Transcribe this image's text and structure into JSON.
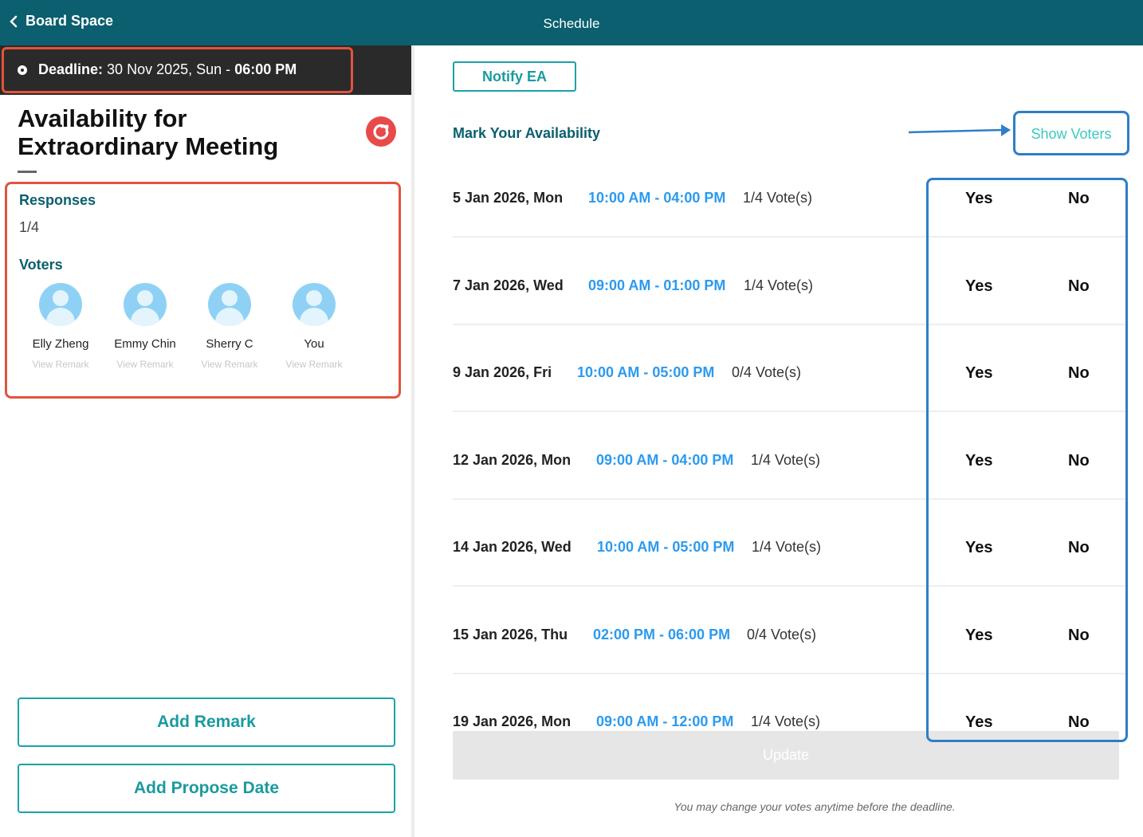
{
  "topbar": {
    "back_label": "Board Space",
    "title": "Schedule"
  },
  "deadline": {
    "label": "Deadline:",
    "date": "30 Nov 2025, Sun",
    "separator": "-",
    "time": "06:00 PM"
  },
  "meeting": {
    "title": "Availability for Extraordinary Meeting"
  },
  "responses": {
    "label": "Responses",
    "value": "1/4",
    "voters_label": "Voters",
    "voters": [
      {
        "name": "Elly Zheng",
        "remark": "View Remark"
      },
      {
        "name": "Emmy Chin",
        "remark": "View Remark"
      },
      {
        "name": "Sherry C",
        "remark": "View Remark"
      },
      {
        "name": "You",
        "remark": "View Remark"
      }
    ]
  },
  "buttons": {
    "add_remark": "Add Remark",
    "add_propose_date": "Add Propose Date",
    "notify_ea": "Notify EA",
    "update": "Update"
  },
  "availability": {
    "heading": "Mark Your Availability",
    "show_voters": "Show Voters",
    "rows": [
      {
        "date": "5 Jan 2026, Mon",
        "time": "10:00 AM - 04:00 PM",
        "votes": "1/4 Vote(s)",
        "yes": "Yes",
        "no": "No"
      },
      {
        "date": "7 Jan 2026, Wed",
        "time": "09:00 AM - 01:00 PM",
        "votes": "1/4 Vote(s)",
        "yes": "Yes",
        "no": "No"
      },
      {
        "date": "9 Jan 2026, Fri",
        "time": "10:00 AM - 05:00 PM",
        "votes": "0/4 Vote(s)",
        "yes": "Yes",
        "no": "No"
      },
      {
        "date": "12 Jan 2026, Mon",
        "time": "09:00 AM - 04:00 PM",
        "votes": "1/4 Vote(s)",
        "yes": "Yes",
        "no": "No"
      },
      {
        "date": "14 Jan 2026, Wed",
        "time": "10:00 AM - 05:00 PM",
        "votes": "1/4 Vote(s)",
        "yes": "Yes",
        "no": "No"
      },
      {
        "date": "15 Jan 2026, Thu",
        "time": "02:00 PM - 06:00 PM",
        "votes": "0/4 Vote(s)",
        "yes": "Yes",
        "no": "No"
      },
      {
        "date": "19 Jan 2026, Mon",
        "time": "09:00 AM - 12:00 PM",
        "votes": "1/4 Vote(s)",
        "yes": "Yes",
        "no": "No"
      }
    ]
  },
  "footer_note": "You may change your votes anytime before the deadline.",
  "colors": {
    "header": "#0b5f6e",
    "accent_teal": "#1aa3a8",
    "time_blue": "#2b9af0",
    "highlight_red": "#e2533f",
    "highlight_blue": "#2f7ec7"
  }
}
